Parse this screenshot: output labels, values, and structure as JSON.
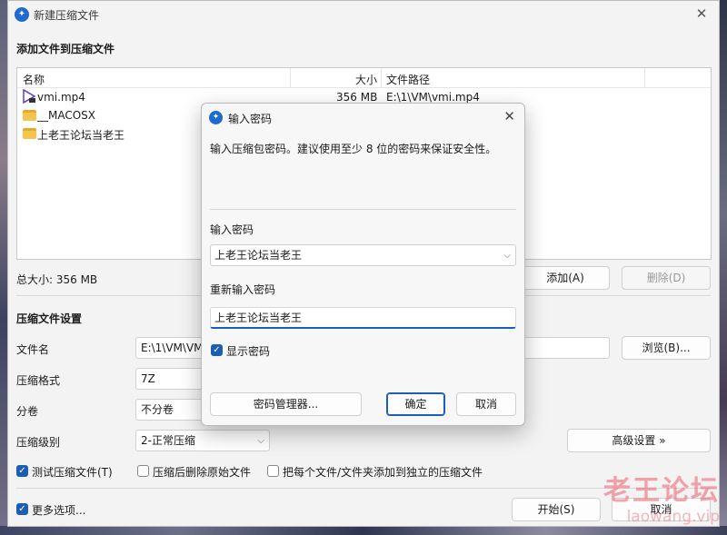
{
  "main": {
    "title": "新建压缩文件",
    "add_section_title": "添加文件到压缩文件",
    "columns": {
      "name": "名称",
      "size": "大小",
      "path": "文件路径"
    },
    "files": [
      {
        "name": "vmi.mp4",
        "size": "356 MB",
        "path": "E:\\1\\VM\\vmi.mp4",
        "icon": "video-file-icon"
      },
      {
        "name": "__MACOSX",
        "size": "",
        "path": "",
        "icon": "folder-icon"
      },
      {
        "name": "上老王论坛当老王",
        "size": "",
        "path": "",
        "icon": "folder-icon"
      }
    ],
    "total_size": "总大小: 356 MB",
    "add_button": "添加(A)",
    "delete_button": "删除(D)",
    "settings_title": "压缩文件设置",
    "filename_label": "文件名",
    "filename_value": "E:\\1\\VM\\VM",
    "browse_button": "浏览(B)...",
    "format_label": "压缩格式",
    "format_value": "7Z",
    "split_label": "分卷",
    "split_value": "不分卷",
    "level_label": "压缩级别",
    "level_value": "2-正常压缩",
    "advanced_button": "高级设置 »",
    "test_checkbox": "测试压缩文件(T)",
    "test_checked": true,
    "delete_after_checkbox": "压缩后删除原始文件",
    "delete_after_checked": false,
    "separate_checkbox": "把每个文件/文件夹添加到独立的压缩文件",
    "separate_checked": false,
    "more_options": "更多选项...",
    "more_checked": true,
    "start_button": "开始(S)",
    "cancel_button": "取消"
  },
  "dialog": {
    "title": "输入密码",
    "hint": "输入压缩包密码。建议使用至少 8 位的密码来保证安全性。",
    "password_label": "输入密码",
    "password_value": "上老王论坛当老王",
    "repeat_label": "重新输入密码",
    "repeat_value": "上老王论坛当老王",
    "show_password": "显示密码",
    "show_checked": true,
    "manager_button": "密码管理器...",
    "ok_button": "确定",
    "cancel_button": "取消"
  },
  "watermark": {
    "text": "老王论坛",
    "url": "laowang.vip"
  },
  "colors": {
    "accent": "#1a5fb4",
    "watermark": "#ee5a69"
  }
}
